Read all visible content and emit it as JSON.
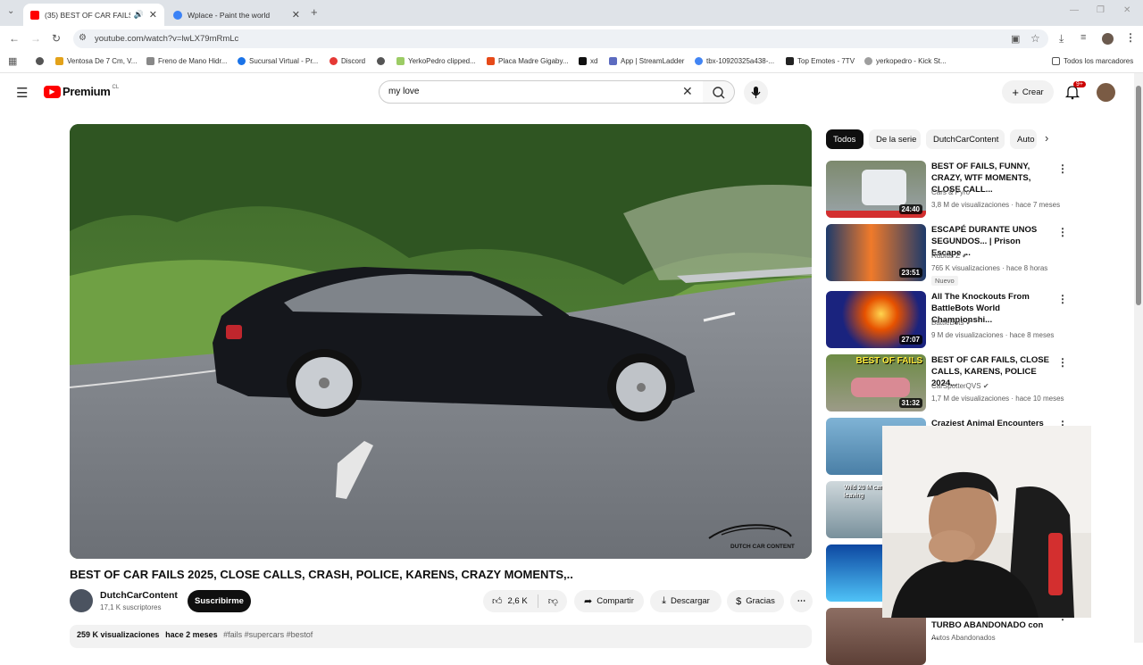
{
  "browser": {
    "tabs": [
      {
        "title": "(35) BEST OF CAR FAILS 2025, CLOSE",
        "favicon": "youtube-icon"
      },
      {
        "title": "Wplace - Paint the world",
        "favicon": "globe-icon"
      }
    ],
    "new_tab": "+",
    "url": "youtube.com/watch?v=lwLX79mRmLc",
    "bookmarks": [
      "Ventosa De 7 Cm, V...",
      "Freno de Mano Hidr...",
      "Sucursal Virtual - Pr...",
      "Discord",
      "YerkoPedro clipped...",
      "Placa Madre Gigaby...",
      "xd",
      "App | StreamLadder",
      "tbx-10920325a438-...",
      "Top Emotes - 7TV",
      "yerkopedro - Kick St..."
    ],
    "all_bookmarks": "Todos los marcadores"
  },
  "youtube": {
    "logo_text": "Premium",
    "logo_region": "CL",
    "search_value": "my love",
    "create_label": "Crear",
    "notif_count": "9+",
    "accent": "#ff0000"
  },
  "video": {
    "title": "BEST OF CAR FAILS 2025, CLOSE CALLS, CRASH, POLICE, KARENS, CRAZY MOMENTS,..",
    "watermark": "DUTCH CAR CONTENT",
    "channel": "DutchCarContent",
    "subscribers": "17,1 K suscriptores",
    "subscribe_label": "Suscribirme",
    "likes": "2,6 K",
    "share_label": "Compartir",
    "download_label": "Descargar",
    "thanks_label": "Gracias",
    "views": "259 K visualizaciones",
    "age": "hace 2 meses",
    "tags": "#fails #supercars #bestof"
  },
  "sidebar": {
    "chips": [
      "Todos",
      "De la serie",
      "DutchCarContent",
      "Auto"
    ],
    "videos": [
      {
        "title": "BEST OF FAILS, FUNNY, CRAZY, WTF MOMENTS, CLOSE CALL...",
        "channel": "Cars & Pyro",
        "meta": "3,8 M de visualizaciones · hace 7 meses",
        "duration": "24:40"
      },
      {
        "title": "ESCAPÉ DURANTE UNOS SEGUNDOS... | Prison Escape ...",
        "channel": "Rubius Z",
        "meta": "765 K visualizaciones · hace 8 horas",
        "duration": "23:51",
        "badge": "Nuevo"
      },
      {
        "title": "All The Knockouts From BattleBots World Championshi...",
        "channel": "BattleBots",
        "meta": "9 M de visualizaciones · hace 8 meses",
        "duration": "27:07"
      },
      {
        "title": "BEST OF CAR FAILS, CLOSE CALLS, KARENS, POLICE 2024...",
        "channel": "CarSpotterQVS",
        "meta": "1,7 M de visualizaciones · hace 10 meses",
        "duration": "31:32",
        "thumb_text": "BEST OF FAILS"
      },
      {
        "title": "Craziest Animal Encounters of",
        "channel": "",
        "meta": "",
        "duration": ""
      },
      {
        "title": "",
        "channel": "",
        "meta": "",
        "duration": "",
        "thumb_text": "Wild 20 M cars leaving"
      },
      {
        "title": "",
        "channel": "",
        "meta": "",
        "duration": ""
      },
      {
        "title": "TURBO ABANDONADO con ...",
        "channel": "Autos Abandonados",
        "meta": "",
        "duration": ""
      }
    ]
  }
}
